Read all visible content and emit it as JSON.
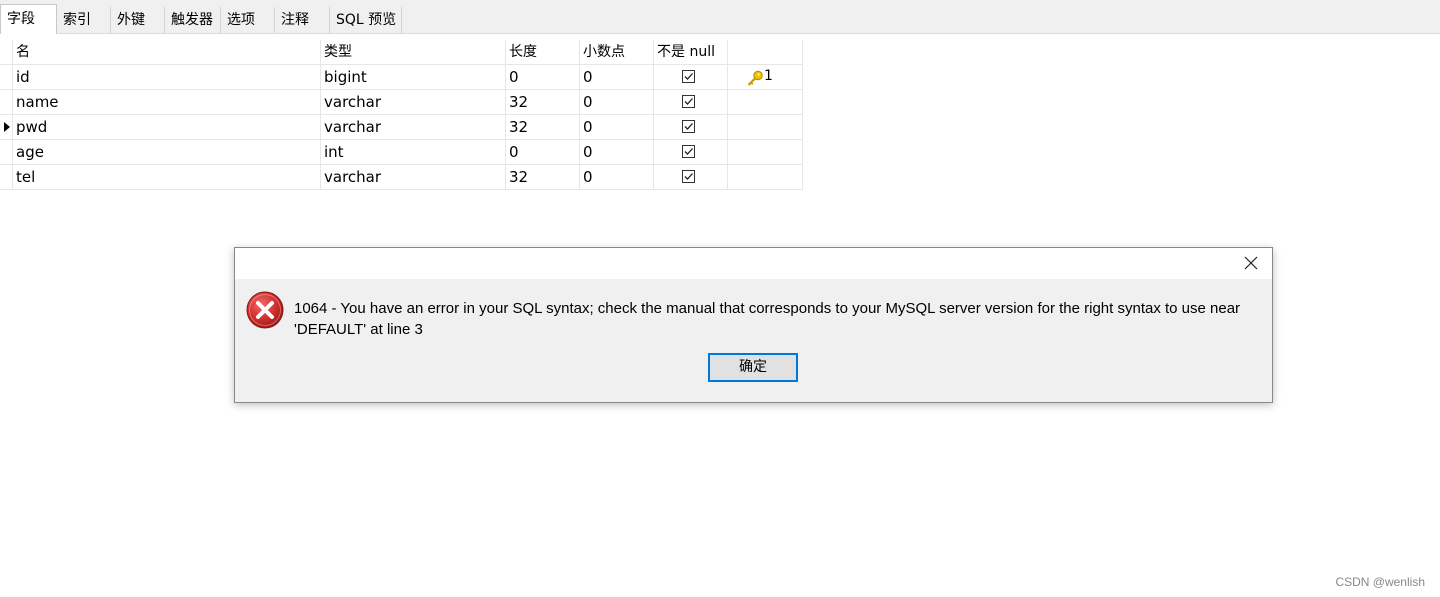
{
  "tabs": [
    {
      "label": "字段",
      "active": true
    },
    {
      "label": "索引"
    },
    {
      "label": "外键"
    },
    {
      "label": "触发器"
    },
    {
      "label": "选项"
    },
    {
      "label": "注释"
    },
    {
      "label": "SQL 预览"
    }
  ],
  "columns": {
    "name": "名",
    "type": "类型",
    "length": "长度",
    "decimals": "小数点",
    "not_null": "不是 null",
    "key": ""
  },
  "fields": [
    {
      "name": "id",
      "type": "bigint",
      "length": "0",
      "decimals": "0",
      "not_null": true,
      "key": "1",
      "current": false
    },
    {
      "name": "name",
      "type": "varchar",
      "length": "32",
      "decimals": "0",
      "not_null": true,
      "key": "",
      "current": false
    },
    {
      "name": "pwd",
      "type": "varchar",
      "length": "32",
      "decimals": "0",
      "not_null": true,
      "key": "",
      "current": true
    },
    {
      "name": "age",
      "type": "int",
      "length": "0",
      "decimals": "0",
      "not_null": true,
      "key": "",
      "current": false
    },
    {
      "name": "tel",
      "type": "varchar",
      "length": "32",
      "decimals": "0",
      "not_null": true,
      "key": "",
      "current": false
    }
  ],
  "dialog": {
    "message": "1064 - You have an error in your SQL syntax; check the manual that corresponds to your MySQL server version for the right syntax to use near 'DEFAULT' at line 3",
    "ok_label": "确定",
    "icon": "error-icon",
    "close_icon": "close-icon"
  },
  "watermark": "CSDN @wenlish",
  "colors": {
    "error_red": "#d32f2f",
    "key_gold": "#e8b400",
    "focus_blue": "#0078d7"
  }
}
